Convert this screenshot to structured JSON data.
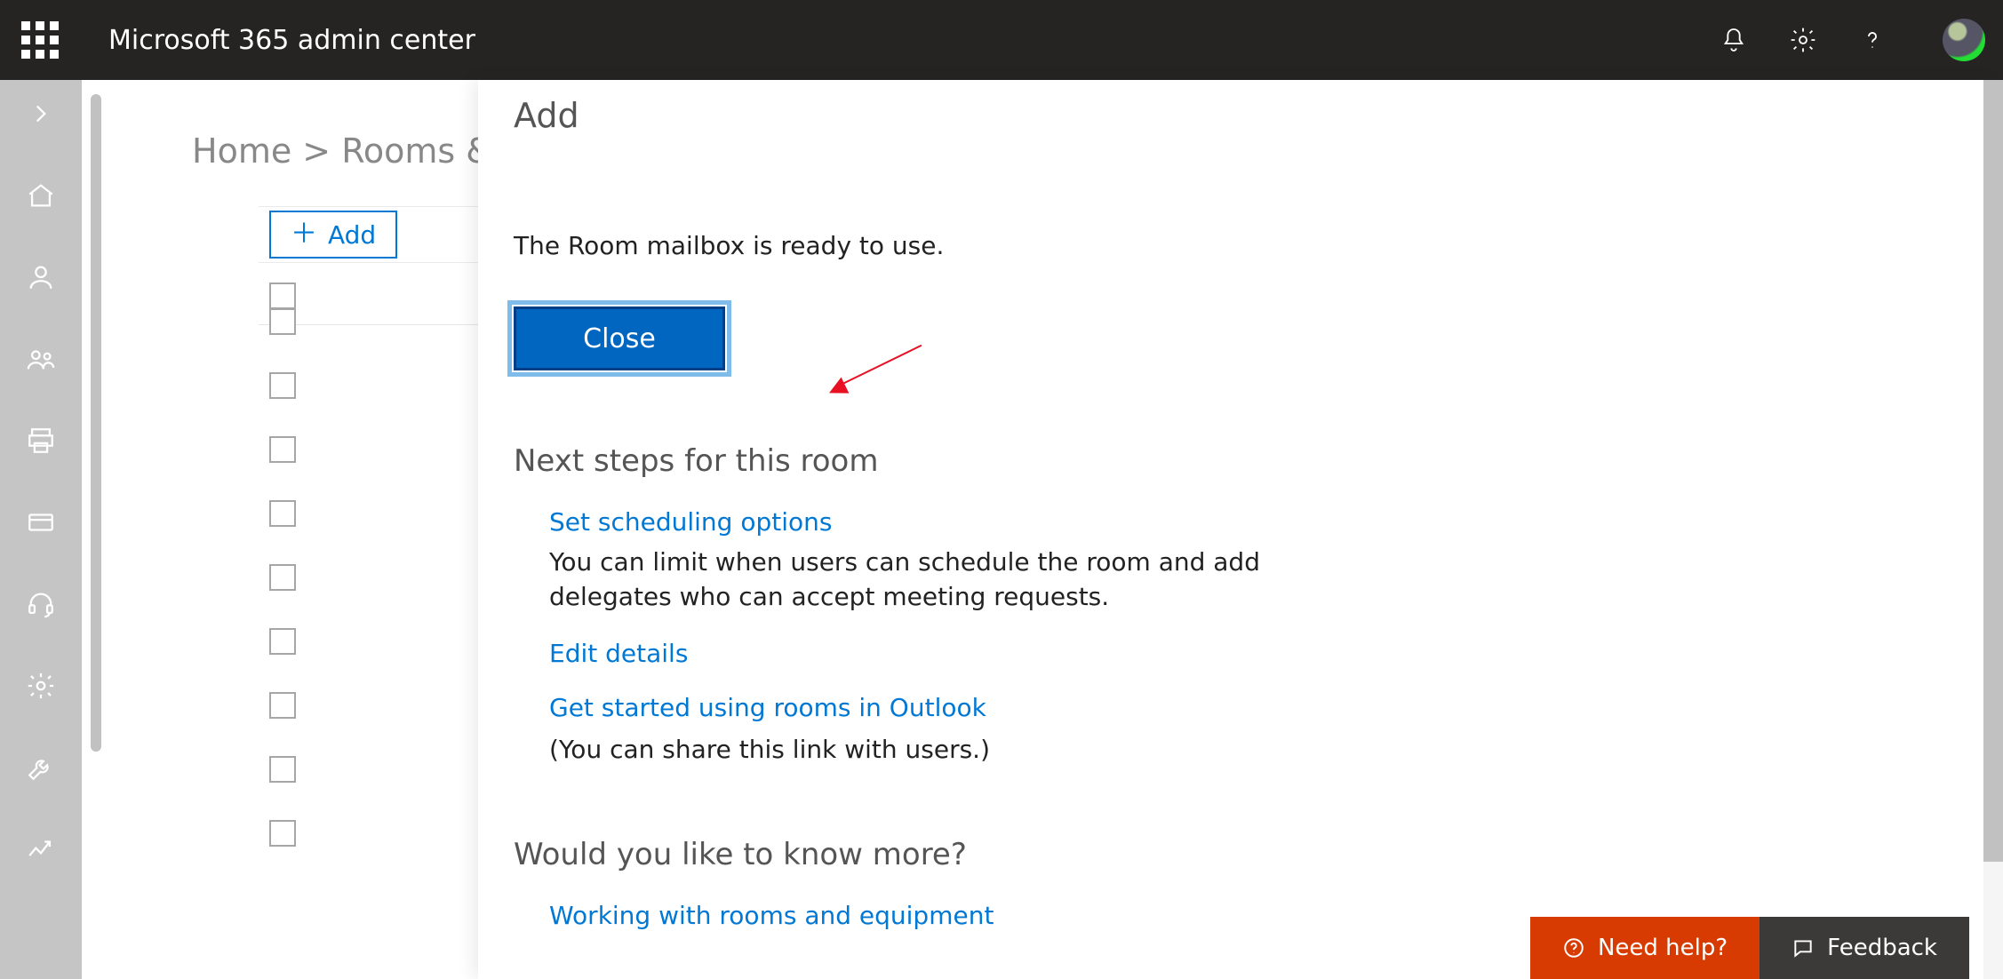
{
  "header": {
    "title": "Microsoft 365 admin center"
  },
  "rail": {
    "items": [
      "expand",
      "home",
      "user",
      "group",
      "billing",
      "card",
      "support",
      "settings",
      "setup",
      "reports"
    ]
  },
  "breadcrumb": {
    "home": "Home",
    "sep": " > ",
    "page": "Rooms &"
  },
  "toolbar": {
    "add": "Add"
  },
  "listRows": [
    0,
    1,
    2,
    3,
    4,
    5,
    6,
    7,
    8
  ],
  "panel": {
    "title": "Add",
    "ready": "The Room mailbox is ready to use.",
    "close": "Close",
    "nextHeading": "Next steps for this room",
    "linkSched": "Set scheduling options",
    "schedDesc": "You can limit when users can schedule the room and add delegates who can accept meeting requests.",
    "linkEdit": "Edit details",
    "linkOutlook": "Get started using rooms in Outlook",
    "outlookNote": "(You can share this link with users.)",
    "moreHeading": "Would you like to know more?",
    "linkWorking": "Working with rooms and equipment"
  },
  "bottom": {
    "help": "Need help?",
    "feedback": "Feedback"
  }
}
